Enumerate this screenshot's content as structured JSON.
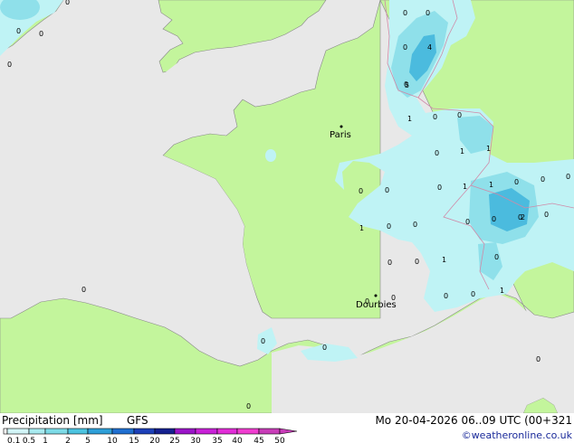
{
  "map": {
    "cities": [
      {
        "name": "Paris"
      },
      {
        "name": "Dourbies"
      }
    ],
    "values": [
      "0",
      "0",
      "0",
      "0",
      "0",
      "0",
      "0",
      "4",
      "0",
      "5",
      "1",
      "0",
      "0",
      "0",
      "1",
      "1",
      "0",
      "0",
      "0",
      "1",
      "1",
      "0",
      "0",
      "0",
      "0",
      "1",
      "0",
      "0",
      "0",
      "0",
      "0",
      "1",
      "0",
      "0",
      "2",
      "0",
      "0",
      "0",
      "0",
      "1",
      "0",
      "0",
      "0",
      "0",
      "0",
      "0"
    ],
    "colors": {
      "sea": "#e8e8e8",
      "land": "#c3f59c",
      "precip_light": "#bff3f5",
      "precip_mid": "#8fe0ea",
      "precip_heavy": "#4bbbde"
    }
  },
  "footer": {
    "title": "Precipitation [mm]",
    "model": "GFS",
    "datetime": "Mo 20-04-2026 06..09 UTC (00+321",
    "credit": "©weatheronline.co.uk"
  },
  "legend": {
    "ticks": [
      "0.1",
      "0.5",
      "1",
      "2",
      "5",
      "10",
      "15",
      "20",
      "25",
      "30",
      "35",
      "40",
      "45",
      "50"
    ],
    "colors": [
      "#ffffff",
      "#d2f5f7",
      "#a8eaef",
      "#7ddbe7",
      "#4cc3e0",
      "#2e9fd8",
      "#1f6fd0",
      "#1c3fb8",
      "#14208f",
      "#9a14c8",
      "#c820d8",
      "#e22cd8",
      "#f03cd0",
      "#c83cb8"
    ]
  }
}
